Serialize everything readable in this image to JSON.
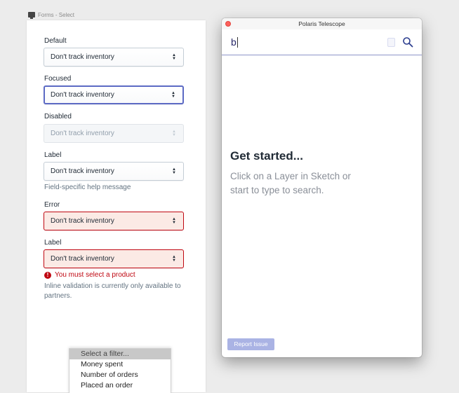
{
  "artboard": {
    "title": "Forms - Select",
    "fields": [
      {
        "label": "Default",
        "value": "Don't track inventory"
      },
      {
        "label": "Focused",
        "value": "Don't track inventory"
      },
      {
        "label": "Disabled",
        "value": "Don't track inventory"
      },
      {
        "label": "Label",
        "value": "Don't track inventory",
        "help": "Field-specific help message"
      },
      {
        "label": "Error",
        "value": "Don't track inventory"
      },
      {
        "label": "Label",
        "value": "Don't track inventory",
        "error": "You must select a product",
        "help": "Inline validation is currently only available to partners."
      }
    ],
    "arrows": "▲▼"
  },
  "filter_dropdown": {
    "options": [
      "Select a filter...",
      "Money spent",
      "Number of orders",
      "Placed an order"
    ],
    "selected_index": 0
  },
  "telescope": {
    "title": "Polaris Telescope",
    "search_value": "b",
    "heading": "Get started...",
    "instructions": "Click on a Layer in Sketch or start to type to search.",
    "report_button": "Report Issue"
  },
  "colors": {
    "focus": "#5c6ac4",
    "error": "#bf0711",
    "error_bg": "#fbeae5",
    "report_button": "#aab3e4"
  }
}
